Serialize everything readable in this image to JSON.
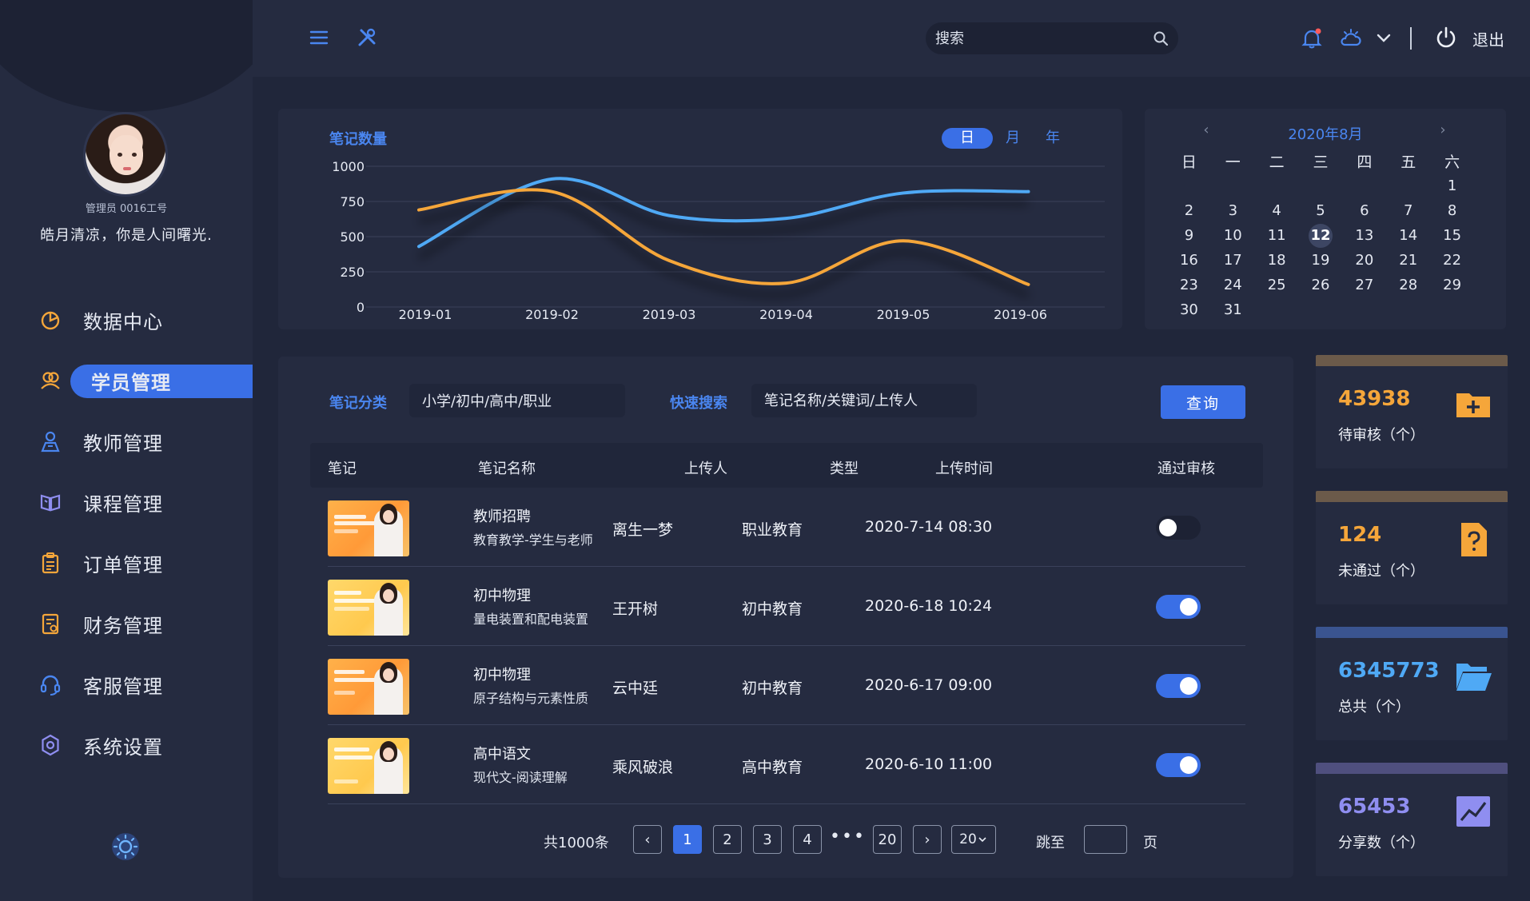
{
  "profile": {
    "admin_id": "管理员 0016工号",
    "motto": "皓月清凉，你是人间曙光."
  },
  "nav": {
    "items": [
      {
        "label": "数据中心",
        "icon": "pie-chart-icon"
      },
      {
        "label": "学员管理",
        "icon": "users-icon",
        "active": true
      },
      {
        "label": "教师管理",
        "icon": "teacher-icon"
      },
      {
        "label": "课程管理",
        "icon": "book-icon"
      },
      {
        "label": "订单管理",
        "icon": "clipboard-icon"
      },
      {
        "label": "财务管理",
        "icon": "finance-doc-icon"
      },
      {
        "label": "客服管理",
        "icon": "headset-icon"
      },
      {
        "label": "系统设置",
        "icon": "gear-icon"
      }
    ]
  },
  "topbar": {
    "search_placeholder": "搜索",
    "logout_label": "退出"
  },
  "notes_chart": {
    "title": "笔记数量",
    "segments": [
      "日",
      "月",
      "年"
    ],
    "active_segment": "日"
  },
  "chart_data": {
    "type": "line",
    "title": "笔记数量",
    "x": [
      "2019-01",
      "2019-02",
      "2019-03",
      "2019-04",
      "2019-05",
      "2019-06"
    ],
    "yticks": [
      0,
      250,
      500,
      750,
      1000
    ],
    "ylim": [
      0,
      1000
    ],
    "series": [
      {
        "color": "#4fa9f5",
        "values": [
          430,
          910,
          650,
          630,
          810,
          820
        ]
      },
      {
        "color": "#f5a63a",
        "values": [
          690,
          820,
          330,
          170,
          470,
          160
        ]
      }
    ],
    "grid": true
  },
  "calendar": {
    "title": "2020年8月",
    "prev": "‹",
    "next": "›",
    "weekdays": [
      "日",
      "一",
      "二",
      "三",
      "四",
      "五",
      "六"
    ],
    "weeks": [
      [
        "",
        "",
        "",
        "",
        "",
        "",
        "1"
      ],
      [
        "2",
        "3",
        "4",
        "5",
        "6",
        "7",
        "8"
      ],
      [
        "9",
        "10",
        "11",
        "12",
        "13",
        "14",
        "15"
      ],
      [
        "16",
        "17",
        "18",
        "19",
        "20",
        "21",
        "22"
      ],
      [
        "23",
        "24",
        "25",
        "26",
        "27",
        "28",
        "29"
      ],
      [
        "30",
        "31",
        "",
        "",
        "",
        "",
        ""
      ]
    ],
    "today": "12"
  },
  "filters": {
    "category_label": "笔记分类",
    "category_value": "小学/初中/高中/职业",
    "quick_label": "快速搜索",
    "quick_placeholder": "笔记名称/关键词/上传人",
    "query_label": "查询"
  },
  "table": {
    "headers": [
      "笔记",
      "笔记名称",
      "上传人",
      "类型",
      "上传时间",
      "通过审核"
    ],
    "rows": [
      {
        "name": "教师招聘",
        "sub": "教育教学-学生与老师",
        "uploader": "离生一梦",
        "type": "职业教育",
        "time": "2020-7-14 08:30",
        "approved": false
      },
      {
        "name": "初中物理",
        "sub": "量电装置和配电装置",
        "uploader": "王开树",
        "type": "初中教育",
        "time": "2020-6-18 10:24",
        "approved": true
      },
      {
        "name": "初中物理",
        "sub": "原子结构与元素性质",
        "uploader": "云中廷",
        "type": "初中教育",
        "time": "2020-6-17 09:00",
        "approved": true
      },
      {
        "name": "高中语文",
        "sub": "现代文-阅读理解",
        "uploader": "乘风破浪",
        "type": "高中教育",
        "time": "2020-6-10 11:00",
        "approved": true
      }
    ]
  },
  "pager": {
    "total": "共1000条",
    "prev": "‹",
    "pages": [
      "1",
      "2",
      "3",
      "4"
    ],
    "ellipsis": "•••",
    "last": "20",
    "next": "›",
    "page_size": "20",
    "jump_label": "跳至",
    "page_label": "页"
  },
  "stats": [
    {
      "value": "43938",
      "label": "待审核（个）",
      "color": "#f5a63a",
      "bar": "#6b5a4a",
      "icon": "folder-plus-icon"
    },
    {
      "value": "124",
      "label": "未通过（个）",
      "color": "#f5a63a",
      "bar": "#6b5a4a",
      "icon": "question-doc-icon"
    },
    {
      "value": "6345773",
      "label": "总共（个）",
      "color": "#4fa9f5",
      "bar": "#3a5490",
      "icon": "open-folder-icon"
    },
    {
      "value": "65453",
      "label": "分享数（个）",
      "color": "#8f8ef0",
      "bar": "#4f4f7e",
      "icon": "trend-chart-icon"
    }
  ]
}
